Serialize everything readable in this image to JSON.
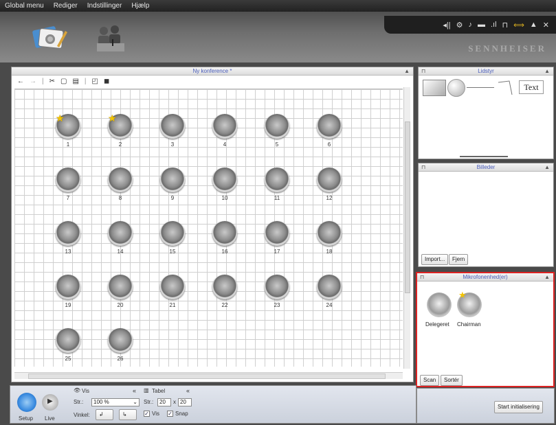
{
  "menu": [
    "Global menu",
    "Rediger",
    "Indstillinger",
    "Hjælp"
  ],
  "header": {
    "brand": "SENNHEISER",
    "tile1_icon": "image-gallery-icon",
    "tile2_icon": "people-podium-icon"
  },
  "canvas": {
    "title": "Ny konference *",
    "toolbar_icons": [
      "undo-icon",
      "redo-icon",
      "cut-icon",
      "copy-icon",
      "paste-icon",
      "bring-front-icon",
      "send-back-icon"
    ],
    "seats": [
      {
        "num": "1",
        "star": true
      },
      {
        "num": "2",
        "star": true
      },
      {
        "num": "3"
      },
      {
        "num": "4"
      },
      {
        "num": "5"
      },
      {
        "num": "6"
      },
      {
        "num": "7"
      },
      {
        "num": "8"
      },
      {
        "num": "9"
      },
      {
        "num": "10"
      },
      {
        "num": "11"
      },
      {
        "num": "12"
      },
      {
        "num": "13"
      },
      {
        "num": "14"
      },
      {
        "num": "15"
      },
      {
        "num": "16"
      },
      {
        "num": "17"
      },
      {
        "num": "18"
      },
      {
        "num": "19"
      },
      {
        "num": "20"
      },
      {
        "num": "21"
      },
      {
        "num": "22"
      },
      {
        "num": "23"
      },
      {
        "num": "24"
      },
      {
        "num": "25"
      },
      {
        "num": "26"
      }
    ]
  },
  "lidstyr": {
    "title": "Lidstyr",
    "text_tool": "Text"
  },
  "billeder": {
    "title": "Billeder",
    "import": "Import...",
    "fjern": "Fjern"
  },
  "mikro": {
    "title": "Mikrofonenhed(er)",
    "items": [
      "Delegeret",
      "Chairman"
    ],
    "scan": "Scan",
    "sort": "Sortér"
  },
  "bottom": {
    "setup": "Setup",
    "live": "Live",
    "vis_title": "Vis",
    "str_label": "Str.:",
    "zoom": "100 %",
    "vinkel_label": "Vinkel:",
    "tabel_title": "Tabel",
    "str2_label": "Str.:",
    "size_w": "20",
    "size_x": "x",
    "size_h": "20",
    "vis_check": "Vis",
    "snap_check": "Snap",
    "start_button": "Start initialisering"
  }
}
